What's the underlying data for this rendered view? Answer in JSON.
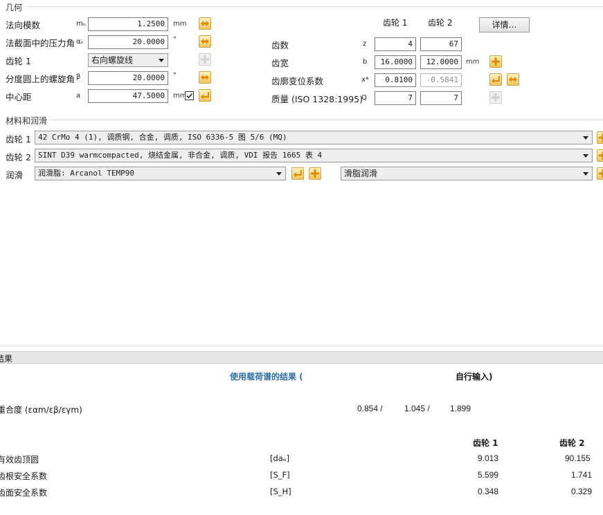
{
  "geometry": {
    "title": "几何",
    "normal_module": {
      "label": "法向模数",
      "sym": "mₙ",
      "value": "1.2500",
      "unit": "mm"
    },
    "pressure_angle": {
      "label": "法截面中的压力角",
      "sym": "αₙ",
      "value": "20.0000",
      "unit": "°"
    },
    "gear1_helix": {
      "label": "齿轮 1",
      "value": "右向螺旋线"
    },
    "helix_angle": {
      "label": "分度圆上的螺旋角",
      "sym": "β",
      "value": "20.0000",
      "unit": "°"
    },
    "center_distance": {
      "label": "中心距",
      "sym": "a",
      "value": "47.5000",
      "unit": "mm"
    },
    "col_gear1": "齿轮 1",
    "col_gear2": "齿轮 2",
    "details_button": "详情…",
    "teeth": {
      "label": "齿数",
      "sym": "z",
      "g1": "4",
      "g2": "67"
    },
    "width": {
      "label": "齿宽",
      "sym": "b",
      "g1": "16.0000",
      "g2": "12.0000",
      "unit": "mm"
    },
    "profile_shift": {
      "label": "齿廓变位系数",
      "sym": "x*",
      "g1": "0.8100",
      "g2": "-0.5841"
    },
    "quality": {
      "label": "质量 (ISO 1328:1995)",
      "sym": "Q",
      "g1": "7",
      "g2": "7"
    }
  },
  "materials": {
    "title": "材料和润滑",
    "gear1": {
      "label": "齿轮 1",
      "value": "42 CrMo 4 (1), 调质钢, 合金, 调质, ISO 6336-5 图 5/6 (MQ)"
    },
    "gear2": {
      "label": "齿轮 2",
      "value": "SINT D39 warmcompacted, 烧结金属, 非合金, 调质, VDI 报告 1665 表 4"
    },
    "lubrication": {
      "label": "润滑",
      "value": "润滑脂: Arcanol TEMP90",
      "type": "滑脂润滑"
    }
  },
  "results": {
    "title": "结果",
    "load_spectrum_header": "使用载荷谱的结果 (",
    "manual_input_header": "自行输入)",
    "contact_ratio": {
      "label": "重合度 (εαm/εβ/εγm)",
      "v1": "0.854 /",
      "v2": "1.045 /",
      "v3": "1.899"
    },
    "col_gear1": "齿轮 1",
    "col_gear2": "齿轮 2",
    "rows": [
      {
        "label": "有效齿顶圆",
        "sym": "[daₑ]",
        "g1": "9.013",
        "g2": "90.155"
      },
      {
        "label": "齿根安全系数",
        "sym": "[S_F]",
        "g1": "5.599",
        "g2": "1.741"
      },
      {
        "label": "齿面安全系数",
        "sym": "[S_H]",
        "g1": "0.348",
        "g2": "0.329"
      }
    ]
  }
}
